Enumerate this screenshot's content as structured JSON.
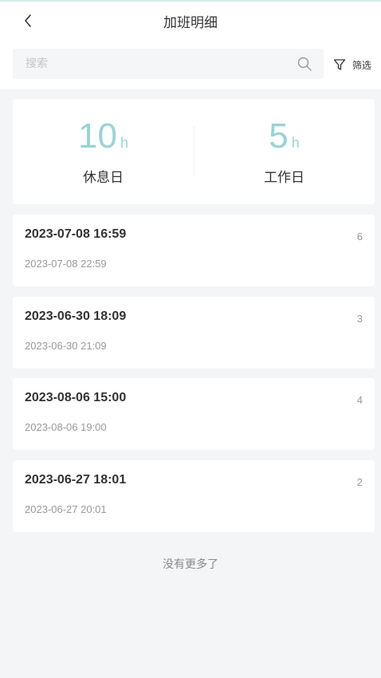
{
  "header": {
    "title": "加班明细"
  },
  "search": {
    "placeholder": "搜索"
  },
  "filter": {
    "label": "筛选"
  },
  "summary": {
    "rest_day": {
      "value": "10",
      "unit": "h",
      "label": "休息日"
    },
    "work_day": {
      "value": "5",
      "unit": "h",
      "label": "工作日"
    }
  },
  "records": [
    {
      "start": "2023-07-08 16:59",
      "end": "2023-07-08 22:59",
      "hours": "6"
    },
    {
      "start": "2023-06-30 18:09",
      "end": "2023-06-30 21:09",
      "hours": "3"
    },
    {
      "start": "2023-08-06 15:00",
      "end": "2023-08-06 19:00",
      "hours": "4"
    },
    {
      "start": "2023-06-27 18:01",
      "end": "2023-06-27 20:01",
      "hours": "2"
    }
  ],
  "footer": {
    "no_more": "没有更多了"
  },
  "colors": {
    "accent": "#9bd2d4",
    "background": "#f4f5f7"
  }
}
